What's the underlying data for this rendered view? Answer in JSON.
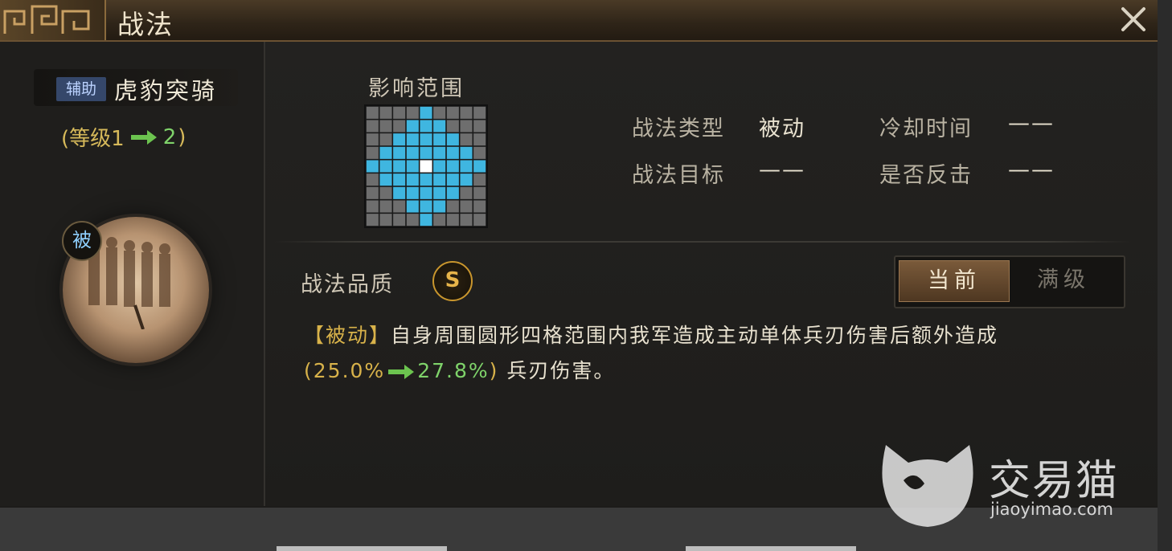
{
  "window": {
    "title": "战法"
  },
  "skill": {
    "tag": "辅助",
    "name": "虎豹突骑",
    "level_prefix": "(等级1",
    "level_to": "2",
    "level_suffix": ")",
    "passive_badge": "被"
  },
  "range": {
    "title": "影响范围",
    "grid_size": 9,
    "radius": 4
  },
  "info": {
    "type_label": "战法类型",
    "type_value": "被动",
    "cooldown_label": "冷却时间",
    "cooldown_value": "——",
    "target_label": "战法目标",
    "target_value": "——",
    "counter_label": "是否反击",
    "counter_value": "——"
  },
  "quality": {
    "label": "战法品质",
    "grade": "S"
  },
  "toggle": {
    "current": "当前",
    "max": "满级"
  },
  "description": {
    "tag": "【被动】",
    "text1": "自身周围圆形四格范围内我军造成主动单体兵刃伤害后额外造成",
    "pct_open": "(25.0%",
    "pct_to": "27.8%",
    "pct_close": ")",
    "text2": " 兵刃伤害。"
  },
  "watermark": {
    "title": "交易猫",
    "url": "jiaoyimao.com"
  },
  "colors": {
    "range_cell": "#3fb6e0",
    "empty_cell": "#6e6e6e",
    "center_cell": "#ffffff",
    "accent_gold": "#d8b24a",
    "accent_green": "#7fd36a"
  }
}
